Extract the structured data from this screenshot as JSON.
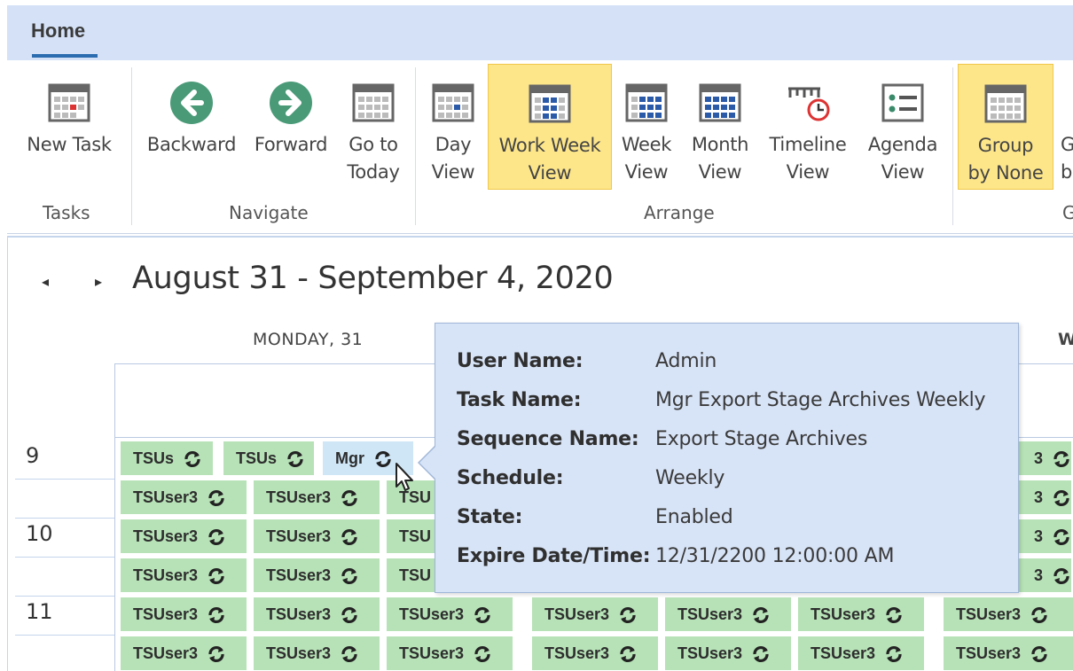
{
  "ribbon": {
    "tab": "Home",
    "buttons": {
      "new_task": "New Task",
      "backward": "Backward",
      "forward": "Forward",
      "go_to_today": "Go to\nToday",
      "day_view": "Day\nView",
      "work_week_view": "Work Week\nView",
      "week_view": "Week\nView",
      "month_view": "Month\nView",
      "timeline_view": "Timeline\nView",
      "agenda_view": "Agenda\nView",
      "group_by_none": "Group\nby None",
      "group_by_partial": "G\nb"
    },
    "groups": {
      "tasks": "Tasks",
      "navigate": "Navigate",
      "arrange": "Arrange",
      "group_partial": "G"
    },
    "active_button": "Work Week View",
    "accent_active": "#fde68a"
  },
  "calendar": {
    "nav_prev": "◂",
    "nav_next": "▸",
    "date_range": "August 31 - September 4, 2020",
    "day_headers": {
      "monday": "MONDAY, 31",
      "partial": "W"
    },
    "hours": [
      "9",
      "10",
      "11"
    ],
    "appointments": {
      "tsus_short": "TSUs",
      "mgr": "Mgr",
      "tsu_partial": "TSU",
      "tsuser3": "TSUser3",
      "partial_3": "3"
    },
    "appointment_color": "#b7e2b7",
    "selected_color": "#cfe6f7",
    "recurrence_icon": "sync-icon"
  },
  "tooltip": {
    "rows": [
      {
        "key": "User Name:",
        "value": "Admin"
      },
      {
        "key": "Task Name:",
        "value": "Mgr Export Stage Archives Weekly"
      },
      {
        "key": "Sequence Name:",
        "value": "Export Stage Archives"
      },
      {
        "key": "Schedule:",
        "value": "Weekly"
      },
      {
        "key": "State:",
        "value": "Enabled"
      },
      {
        "key": "Expire Date/Time:",
        "value": "12/31/2200 12:00:00 AM"
      }
    ],
    "background": "#d7e3f6"
  }
}
